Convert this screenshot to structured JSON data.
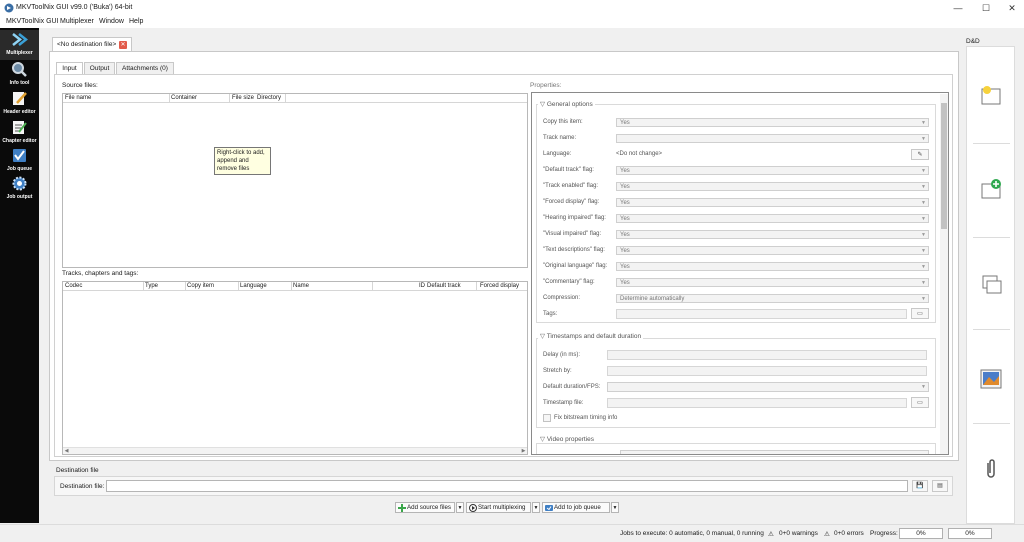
{
  "window": {
    "title": "MKVToolNix GUI v99.0 ('Buka') 64-bit",
    "controls": {
      "minimize": "—",
      "maximize": "☐",
      "close": "✕"
    }
  },
  "menu": [
    "MKVToolNix GUI",
    "Multiplexer",
    "Window",
    "Help"
  ],
  "sidebar": {
    "items": [
      {
        "label": "Multiplexer",
        "icon": "multiplexer-icon"
      },
      {
        "label": "Info tool",
        "icon": "info-tool-icon"
      },
      {
        "label": "Header editor",
        "icon": "header-editor-icon"
      },
      {
        "label": "Chapter editor",
        "icon": "chapter-editor-icon"
      },
      {
        "label": "Job queue",
        "icon": "job-queue-icon"
      },
      {
        "label": "Job output",
        "icon": "job-output-icon"
      }
    ]
  },
  "doc_tab": {
    "label": "<No destination file>"
  },
  "subtabs": [
    "Input",
    "Output",
    "Attachments (0)"
  ],
  "source_files": {
    "label": "Source files:",
    "columns": [
      "File name",
      "Container",
      "File size",
      "Directory"
    ],
    "tooltip": [
      "Right-click to add,",
      "append and",
      "remove files"
    ]
  },
  "tracks": {
    "label": "Tracks, chapters and tags:",
    "columns": [
      "Codec",
      "Type",
      "Copy item",
      "Language",
      "Name",
      "ID",
      "Default track",
      "Forced display"
    ]
  },
  "properties": {
    "label": "Properties:",
    "general": {
      "title": "General options",
      "rows": [
        {
          "label": "Copy this item:",
          "value": "Yes",
          "kind": "combo"
        },
        {
          "label": "Track name:",
          "value": "",
          "kind": "combo"
        },
        {
          "label": "Language:",
          "value": "<Do not change>",
          "kind": "lang"
        },
        {
          "label": "\"Default track\" flag:",
          "value": "Yes",
          "kind": "combo"
        },
        {
          "label": "\"Track enabled\" flag:",
          "value": "Yes",
          "kind": "combo"
        },
        {
          "label": "\"Forced display\" flag:",
          "value": "Yes",
          "kind": "combo"
        },
        {
          "label": "\"Hearing impaired\" flag:",
          "value": "Yes",
          "kind": "combo"
        },
        {
          "label": "\"Visual impaired\" flag:",
          "value": "Yes",
          "kind": "combo"
        },
        {
          "label": "\"Text descriptions\" flag:",
          "value": "Yes",
          "kind": "combo"
        },
        {
          "label": "\"Original language\" flag:",
          "value": "Yes",
          "kind": "combo"
        },
        {
          "label": "\"Commentary\" flag:",
          "value": "Yes",
          "kind": "combo"
        },
        {
          "label": "Compression:",
          "value": "Determine automatically",
          "kind": "combo"
        },
        {
          "label": "Tags:",
          "value": "",
          "kind": "file"
        }
      ]
    },
    "timestamps": {
      "title": "Timestamps and default duration",
      "rows": [
        {
          "label": "Delay (in ms):"
        },
        {
          "label": "Stretch by:"
        },
        {
          "label": "Default duration/FPS:"
        },
        {
          "label": "Timestamp file:"
        }
      ],
      "checkbox": "Fix bitstream timing info"
    },
    "video": {
      "title": "Video properties"
    }
  },
  "destination": {
    "section": "Destination file",
    "label": "Destination file:",
    "value": ""
  },
  "actions": {
    "add": "Add source files",
    "start": "Start multiplexing",
    "queue": "Add to job queue"
  },
  "dnd": {
    "label": "D&D"
  },
  "status": {
    "jobs": "Jobs to execute:  0 automatic, 0 manual, 0 running",
    "warnings": "0+0 warnings",
    "errors": "0+0 errors",
    "progress_label": "Progress:",
    "progress1": "0%",
    "progress2": "0%"
  }
}
